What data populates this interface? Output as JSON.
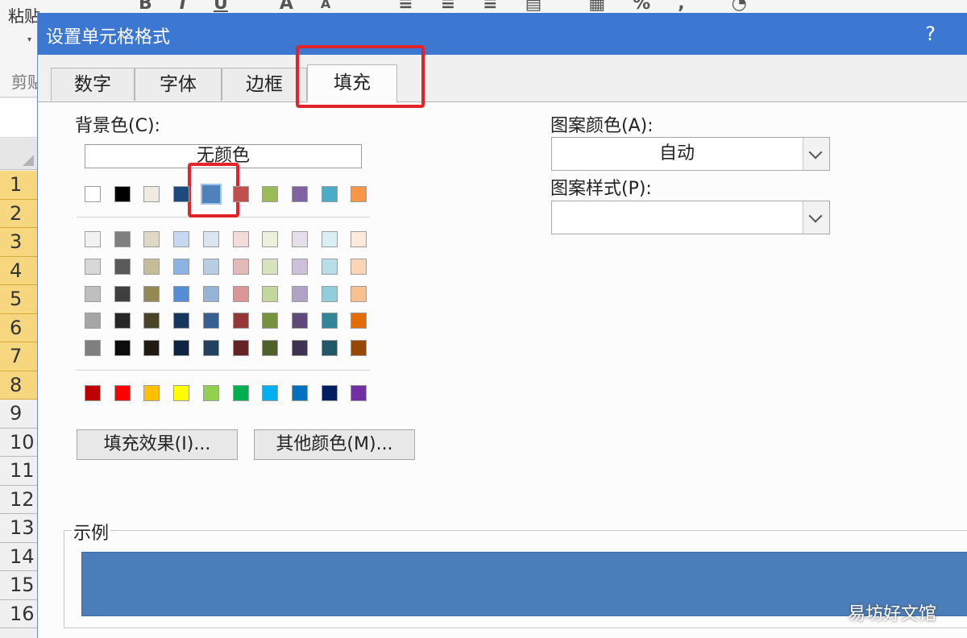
{
  "excel": {
    "paste_label": "粘贴",
    "paste_arrow": "▾",
    "clipboard_label": "剪贴",
    "row_numbers": [
      "1",
      "2",
      "3",
      "4",
      "5",
      "6",
      "7",
      "8",
      "9",
      "10",
      "11",
      "12",
      "13",
      "14",
      "15",
      "16"
    ],
    "highlighted_rows": 8
  },
  "dialog": {
    "title": "设置单元格格式",
    "help": "?",
    "tabs": [
      {
        "label": "数字"
      },
      {
        "label": "字体"
      },
      {
        "label": "边框"
      },
      {
        "label": "填充",
        "active": true
      }
    ],
    "background_color": {
      "label": "背景色(C):",
      "no_color_label": "无颜色",
      "selected_swatch": {
        "row": 0,
        "col": 4,
        "color": "#4f81bd"
      },
      "theme_top": [
        "#ffffff",
        "#000000",
        "#eeece1",
        "#1f497d",
        "#4f81bd",
        "#c0504d",
        "#9bbb59",
        "#8064a2",
        "#4bacc6",
        "#f79646"
      ],
      "theme_shades": [
        [
          "#f2f2f2",
          "#7f7f7f",
          "#ddd9c3",
          "#c6d9f0",
          "#dbe5f1",
          "#f2dcdb",
          "#ebf1dd",
          "#e5e0ec",
          "#dbeef3",
          "#fdeada"
        ],
        [
          "#d8d8d8",
          "#595959",
          "#c4bd97",
          "#8db3e2",
          "#b8cce4",
          "#e5b9b7",
          "#d7e3bc",
          "#ccc1d9",
          "#b7dde8",
          "#fbd5b5"
        ],
        [
          "#bfbfbf",
          "#3f3f3f",
          "#938953",
          "#548dd4",
          "#95b3d7",
          "#d99694",
          "#c3d69b",
          "#b2a2c7",
          "#92cddc",
          "#fac08f"
        ],
        [
          "#a5a5a5",
          "#262626",
          "#494429",
          "#17365d",
          "#366092",
          "#953734",
          "#76923c",
          "#5f497a",
          "#31859b",
          "#e36c09"
        ],
        [
          "#7f7f7f",
          "#0c0c0c",
          "#1d1b10",
          "#0f243e",
          "#244061",
          "#632423",
          "#4f6128",
          "#3f3151",
          "#205867",
          "#974806"
        ]
      ],
      "standard": [
        "#c00000",
        "#ff0000",
        "#ffc000",
        "#ffff00",
        "#92d050",
        "#00b050",
        "#00b0f0",
        "#0070c0",
        "#002060",
        "#7030a0"
      ]
    },
    "fill_effects_button": "填充效果(I)...",
    "more_colors_button": "其他颜色(M)...",
    "pattern_color": {
      "label": "图案颜色(A):",
      "value": "自动"
    },
    "pattern_style": {
      "label": "图案样式(P):",
      "value": ""
    },
    "sample": {
      "label": "示例",
      "color": "#4a7ebb"
    }
  },
  "watermark": "易坊好文馆"
}
